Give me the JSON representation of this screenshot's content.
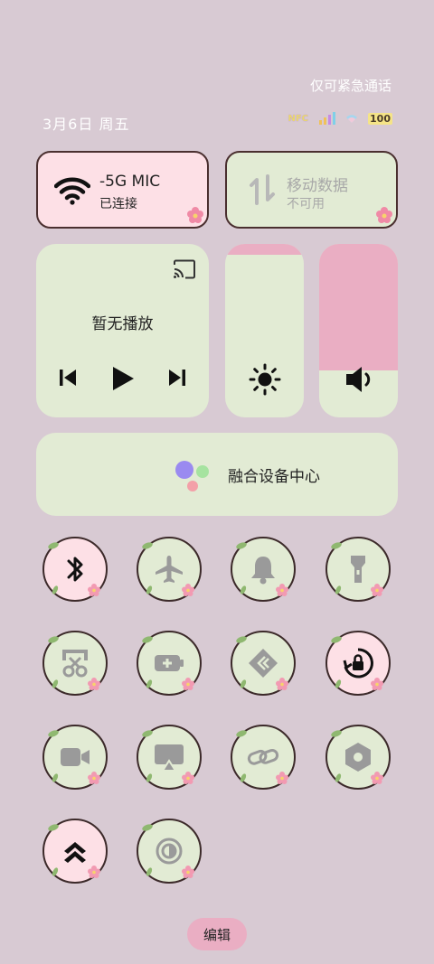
{
  "header": {
    "emergency_text": "仅可紧急通话",
    "date_text": "3月6日 周五",
    "nfc_label": "NFC",
    "battery_text": "100"
  },
  "wifi_tile": {
    "name": "-5G    MIC",
    "status": "已连接",
    "icon": "wifi-icon",
    "state": "on"
  },
  "mobile_tile": {
    "name": "移动数据",
    "status": "不可用",
    "icon": "mobile-data-icon",
    "state": "unavailable"
  },
  "media": {
    "title": "暂无播放",
    "controls": [
      "previous-icon",
      "play-icon",
      "next-icon"
    ]
  },
  "brightness": {
    "icon": "brightness-icon",
    "level": 0.06
  },
  "volume": {
    "icon": "volume-icon",
    "level": 0.73
  },
  "device_center": {
    "label": "融合设备中心"
  },
  "toggles": [
    {
      "name": "bluetooth-icon",
      "state": "on"
    },
    {
      "name": "airplane-icon",
      "state": "off"
    },
    {
      "name": "bell-icon",
      "state": "off"
    },
    {
      "name": "flashlight-icon",
      "state": "off"
    },
    {
      "name": "screenshot-icon",
      "state": "off"
    },
    {
      "name": "battery-saver-icon",
      "state": "off"
    },
    {
      "name": "share-icon",
      "state": "off"
    },
    {
      "name": "rotation-lock-icon",
      "state": "on"
    },
    {
      "name": "screen-record-icon",
      "state": "off"
    },
    {
      "name": "screen-cast-icon",
      "state": "off"
    },
    {
      "name": "link-icon",
      "state": "off"
    },
    {
      "name": "settings-hexagon-icon",
      "state": "off"
    },
    {
      "name": "performance-mode-icon",
      "state": "on"
    },
    {
      "name": "eye-comfort-icon",
      "state": "off"
    }
  ],
  "edit_button": {
    "label": "编辑"
  },
  "colors": {
    "background": "#d8cad3",
    "pink_tile": "#fde0e6",
    "green_tile": "#e2ebd4",
    "accent_pink": "#eaaec3",
    "border": "#4a2f2f"
  }
}
